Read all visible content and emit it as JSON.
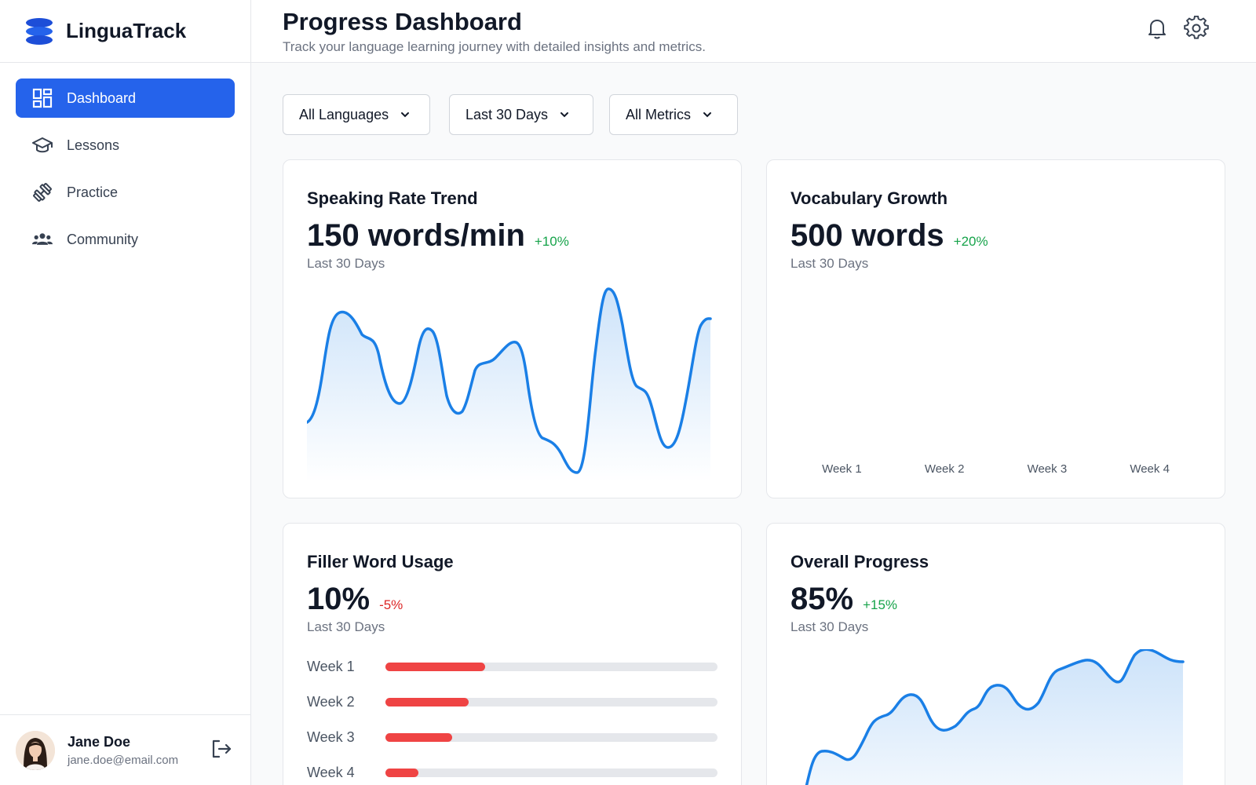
{
  "brand": {
    "name": "LinguaTrack"
  },
  "sidebar": {
    "items": [
      {
        "label": "Dashboard",
        "icon": "dashboard-icon",
        "active": true
      },
      {
        "label": "Lessons",
        "icon": "graduation-cap-icon",
        "active": false
      },
      {
        "label": "Practice",
        "icon": "dumbbell-icon",
        "active": false
      },
      {
        "label": "Community",
        "icon": "people-icon",
        "active": false
      }
    ]
  },
  "user": {
    "name": "Jane Doe",
    "email": "jane.doe@email.com"
  },
  "header": {
    "title": "Progress Dashboard",
    "subtitle": "Track your language learning journey with detailed insights and metrics."
  },
  "filters": {
    "language": "All Languages",
    "period": "Last 30 Days",
    "metrics": "All Metrics"
  },
  "cards": {
    "speaking": {
      "title": "Speaking Rate Trend",
      "value": "150 words/min",
      "delta": "+10%",
      "period": "Last 30 Days"
    },
    "vocabulary": {
      "title": "Vocabulary Growth",
      "value": "500 words",
      "delta": "+20%",
      "period": "Last 30 Days",
      "weeks": [
        "Week 1",
        "Week 2",
        "Week 3",
        "Week 4"
      ]
    },
    "filler": {
      "title": "Filler Word Usage",
      "value": "10%",
      "delta": "-5%",
      "period": "Last 30 Days",
      "rows": [
        {
          "label": "Week 1",
          "fraction": 0.3
        },
        {
          "label": "Week 2",
          "fraction": 0.25
        },
        {
          "label": "Week 3",
          "fraction": 0.2
        },
        {
          "label": "Week 4",
          "fraction": 0.1
        }
      ]
    },
    "overall": {
      "title": "Overall Progress",
      "value": "85%",
      "delta": "+15%",
      "period": "Last 30 Days"
    }
  },
  "colors": {
    "primary": "#2563eb",
    "line": "#1a7fe6",
    "positive": "#16a34a",
    "negative": "#dc2626",
    "bar": "#ef4444"
  }
}
